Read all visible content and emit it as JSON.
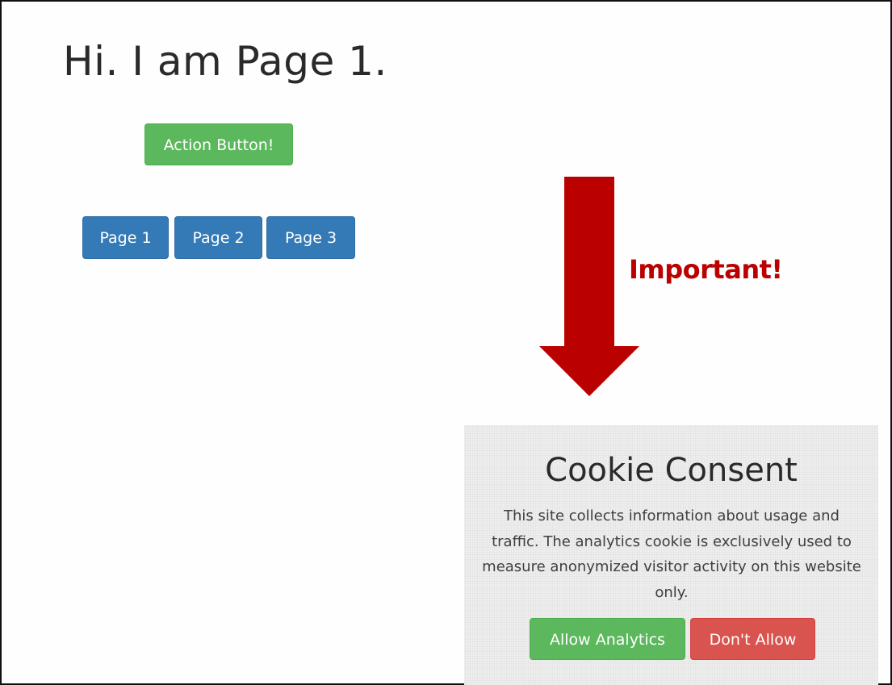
{
  "page": {
    "title": "Hi. I am Page 1."
  },
  "actions": {
    "action_button_label": "Action Button!"
  },
  "pager": {
    "items": [
      {
        "label": "Page 1"
      },
      {
        "label": "Page 2"
      },
      {
        "label": "Page 3"
      }
    ]
  },
  "annotation": {
    "label": "Important!",
    "color": "#bb0000",
    "arrow_icon": "arrow-down-icon"
  },
  "cookie_consent": {
    "title": "Cookie Consent",
    "text": "This site collects information about usage and traffic. The analytics cookie is exclusively used to measure anonymized visitor activity on this website only.",
    "allow_label": "Allow Analytics",
    "deny_label": "Don't Allow"
  },
  "colors": {
    "success": "#5cb85c",
    "primary": "#337ab7",
    "danger": "#d9534f"
  }
}
